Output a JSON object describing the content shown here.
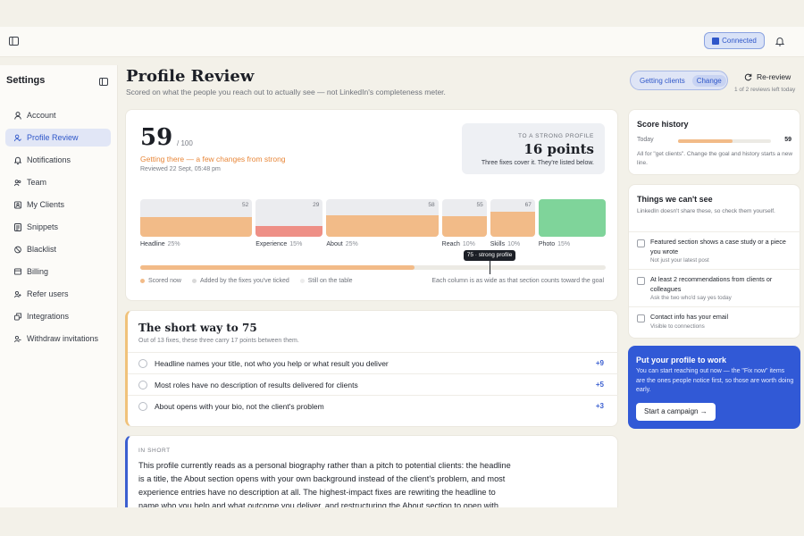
{
  "topbar": {
    "connected_label": "Connected"
  },
  "sidebar": {
    "title": "Settings",
    "items": [
      {
        "label": "Account",
        "icon": "user-icon"
      },
      {
        "label": "Profile Review",
        "icon": "user-check-icon",
        "active": true
      },
      {
        "label": "Notifications",
        "icon": "bell-icon"
      },
      {
        "label": "Team",
        "icon": "team-icon"
      },
      {
        "label": "My Clients",
        "icon": "clients-icon"
      },
      {
        "label": "Snippets",
        "icon": "snippet-icon"
      },
      {
        "label": "Blacklist",
        "icon": "block-icon"
      },
      {
        "label": "Billing",
        "icon": "card-icon"
      },
      {
        "label": "Refer users",
        "icon": "refer-icon"
      },
      {
        "label": "Integrations",
        "icon": "integrations-icon"
      },
      {
        "label": "Withdraw invitations",
        "icon": "withdraw-icon"
      }
    ]
  },
  "header": {
    "title": "Profile Review",
    "subtitle": "Scored on what the people you reach out to actually see — not LinkedIn's completeness meter.",
    "goal_label": "Getting clients",
    "change_label": "Change",
    "rereview_label": "Re-review",
    "reviews_left": "1 of 2 reviews left today"
  },
  "score": {
    "value": "59",
    "out_of": "/ 100",
    "status": "Getting there — a few changes from strong",
    "reviewed": "Reviewed 22 Sept, 05:48 pm",
    "target_caption": "TO A STRONG PROFILE",
    "target_points": "16 points",
    "target_note": "Three fixes cover it. They're listed below.",
    "marker_label": "75 · strong profile",
    "strong_threshold": 75,
    "progress": 59,
    "legend": [
      "Scored now",
      "Added by the fixes you've ticked",
      "Still on the table"
    ],
    "legend_note": "Each column is as wide as that section counts toward the goal"
  },
  "sections": [
    {
      "name": "Headline",
      "weight": "25%",
      "score": "52",
      "fill": 0.52,
      "color": "#f2bb88"
    },
    {
      "name": "Experience",
      "weight": "15%",
      "score": "29",
      "fill": 0.29,
      "color": "#ee8f86"
    },
    {
      "name": "About",
      "weight": "25%",
      "score": "58",
      "fill": 0.58,
      "color": "#f2bb88"
    },
    {
      "name": "Reach",
      "weight": "10%",
      "score": "55",
      "fill": 0.55,
      "color": "#f2bb88"
    },
    {
      "name": "Skills",
      "weight": "10%",
      "score": "67",
      "fill": 0.67,
      "color": "#f2bb88"
    },
    {
      "name": "Photo",
      "weight": "15%",
      "score": "",
      "fill": 1.0,
      "color": "#7fd49a"
    }
  ],
  "shortway": {
    "title": "The short way to 75",
    "subtitle": "Out of 13 fixes, these three carry 17 points between them.",
    "fixes": [
      {
        "text": "Headline names your title, not who you help or what result you deliver",
        "points": "+9"
      },
      {
        "text": "Most roles have no description of results delivered for clients",
        "points": "+5"
      },
      {
        "text": "About opens with your bio, not the client's problem",
        "points": "+3"
      }
    ]
  },
  "inshort": {
    "label": "IN SHORT",
    "lines": [
      "This profile currently reads as a personal biography rather than a pitch to potential clients: the headline",
      "is a title, the About section opens with your own background instead of the client's problem, and most",
      "experience entries have no description at all. The highest-impact fixes are rewriting the headline to",
      "name who you help and what outcome you deliver, and restructuring the About section to open with"
    ]
  },
  "history": {
    "title": "Score history",
    "row_label": "Today",
    "row_value": "59",
    "row_fraction": 0.59,
    "note": "All for \"get clients\". Change the goal and history starts a new line."
  },
  "cantsee": {
    "title": "Things we can't see",
    "subtitle": "LinkedIn doesn't share these, so check them yourself.",
    "items": [
      {
        "title": "Featured section shows a case study or a piece you wrote",
        "sub": "Not just your latest post"
      },
      {
        "title": "At least 2 recommendations from clients or colleagues",
        "sub": "Ask the two who'd say yes today"
      },
      {
        "title": "Contact info has your email",
        "sub": "Visible to connections"
      }
    ]
  },
  "promo": {
    "title": "Put your profile to work",
    "body": "You can start reaching out now — the \"Fix now\" items are the ones people notice first, so those are worth doing early.",
    "button": "Start a campaign →"
  }
}
